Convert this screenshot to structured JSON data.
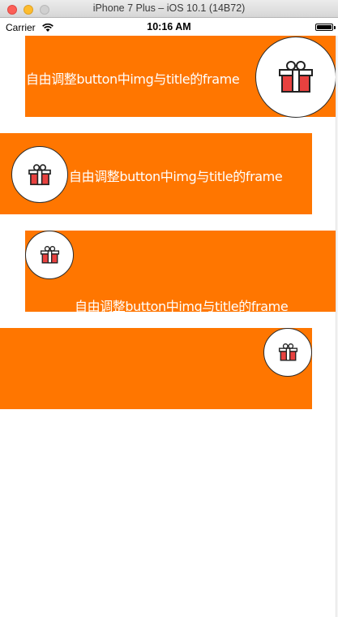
{
  "window": {
    "title": "iPhone 7 Plus – iOS 10.1 (14B72)"
  },
  "status_bar": {
    "carrier": "Carrier",
    "time": "10:16 AM"
  },
  "buttons": [
    {
      "title": "自由调整button中img与title的frame",
      "icon": "gift-icon"
    },
    {
      "title": "自由调整button中img与title的frame",
      "icon": "gift-icon"
    },
    {
      "title": "自由调整button中img与title的frame",
      "icon": "gift-icon"
    },
    {
      "title": "",
      "icon": "gift-icon"
    }
  ],
  "colors": {
    "button_bg": "#ff7600",
    "badge_bg": "#ffffff",
    "gift_red": "#e8413f"
  }
}
